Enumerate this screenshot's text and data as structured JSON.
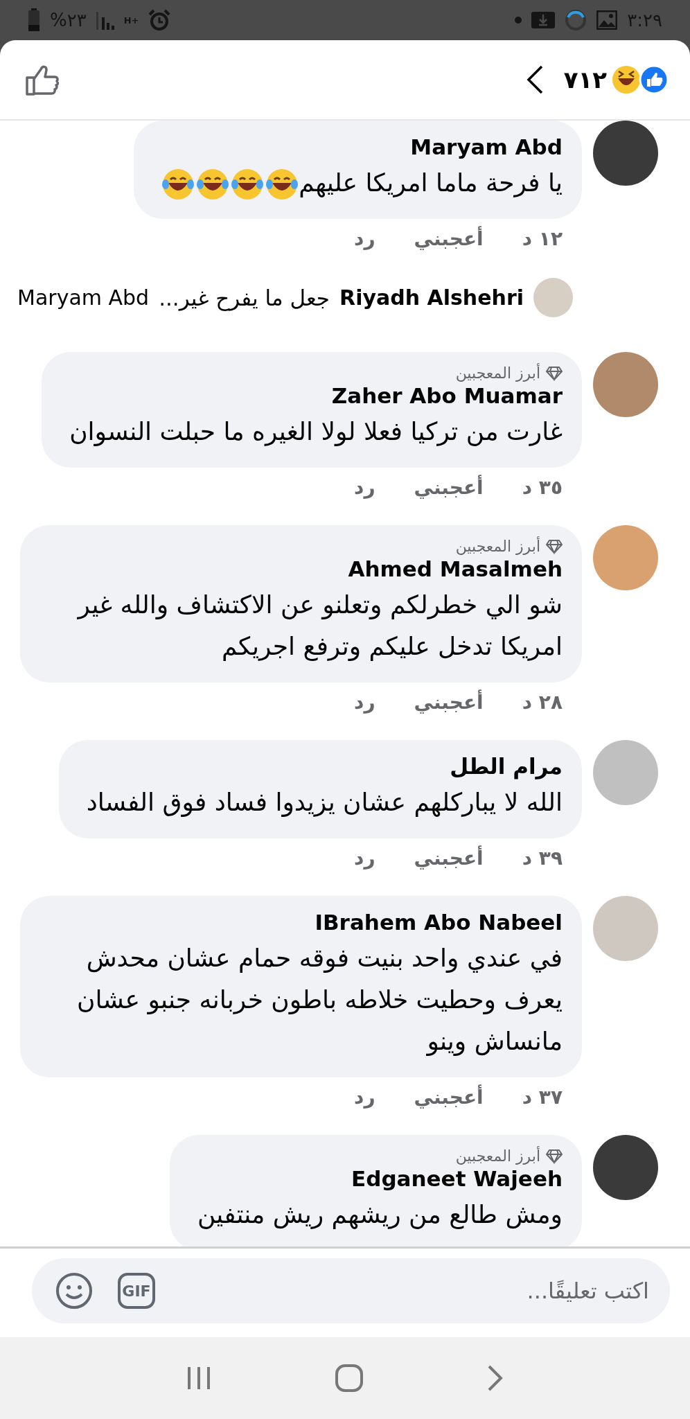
{
  "status_bar": {
    "time": "٣:٢٩",
    "battery": "%٢٣",
    "network": "H+"
  },
  "header": {
    "reaction_count": "٧١٢"
  },
  "comments": [
    {
      "kind": "comment",
      "author": "Maryam Abd",
      "text": "يا فرحة ماما امريكا عليهم",
      "trailing_emoji": [
        {
          "kind": "tears-of-joy"
        },
        {
          "kind": "tears-of-joy"
        },
        {
          "kind": "tears-of-joy"
        },
        {
          "kind": "tears-of-joy"
        }
      ],
      "time": "١٢ د",
      "like_label": "أعجبني",
      "reply_label": "رد"
    },
    {
      "kind": "reply_preview",
      "author": "Riyadh Alshehri",
      "text": "جعل ما يفرح غير...",
      "mention": "Maryam Abd"
    },
    {
      "kind": "comment",
      "badge": "أبرز المعجبين",
      "author": "Zaher Abo Muamar",
      "text": "غارت من تركيا فعلا لولا الغيره ما حبلت النسوان",
      "time": "٣٥ د",
      "like_label": "أعجبني",
      "reply_label": "رد"
    },
    {
      "kind": "comment",
      "badge": "أبرز المعجبين",
      "author": "Ahmed Masalmeh",
      "text": "شو الي خطرلكم وتعلنو عن الاكتشاف والله غير امريكا تدخل عليكم وترفع اجريكم",
      "time": "٢٨ د",
      "like_label": "أعجبني",
      "reply_label": "رد"
    },
    {
      "kind": "comment",
      "author": "مرام الطل",
      "text": "الله لا يباركلهم عشان يزيدوا فساد فوق الفساد",
      "time": "٣٩ د",
      "like_label": "أعجبني",
      "reply_label": "رد"
    },
    {
      "kind": "comment",
      "author": "IBrahem Abo Nabeel",
      "text": "في عندي واحد بنيت فوقه حمام عشان محدش يعرف وحطيت خلاطه باطون خربانه جنبو عشان مانساش وينو",
      "time": "٣٧ د",
      "like_label": "أعجبني",
      "reply_label": "رد"
    },
    {
      "kind": "comment",
      "badge": "أبرز المعجبين",
      "author": "Edganeet Wajeeh",
      "text": "ومش طالع من ريشهم ريش منتفين"
    }
  ],
  "composer": {
    "placeholder": "اكتب تعليقًا...",
    "gif_label": "GIF"
  }
}
